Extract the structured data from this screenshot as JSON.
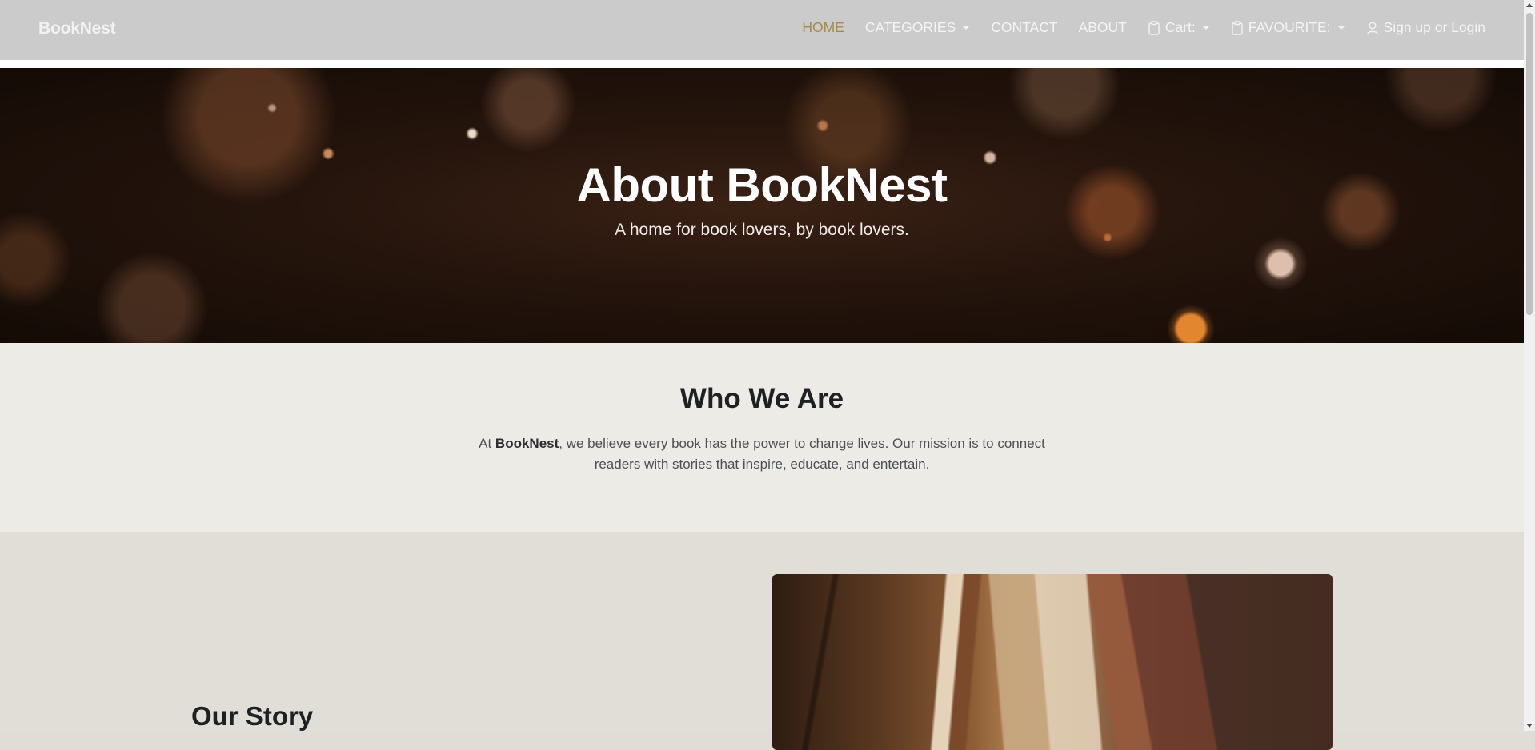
{
  "navbar": {
    "brand": "BookNest",
    "links": {
      "home": "HOME",
      "categories": "CATEGORIES",
      "contact": "CONTACT",
      "about": "ABOUT",
      "cart": "Cart:",
      "favourite": "FAVOURITE:",
      "login": "Sign up or Login"
    },
    "active_link": "HOME",
    "active_color": "#a38a4e",
    "icons": {
      "cart": "clipboard-icon",
      "favourite": "clipboard-icon",
      "login": "person-icon"
    }
  },
  "hero": {
    "title": "About BookNest",
    "subtitle": "A home for book lovers, by book lovers."
  },
  "who": {
    "title": "Who We Are",
    "text_prefix": "At ",
    "text_brand": "BookNest",
    "text_suffix": ", we believe every book has the power to change lives. Our mission is to connect readers with stories that inspire, educate, and entertain."
  },
  "story": {
    "title": "Our Story"
  }
}
